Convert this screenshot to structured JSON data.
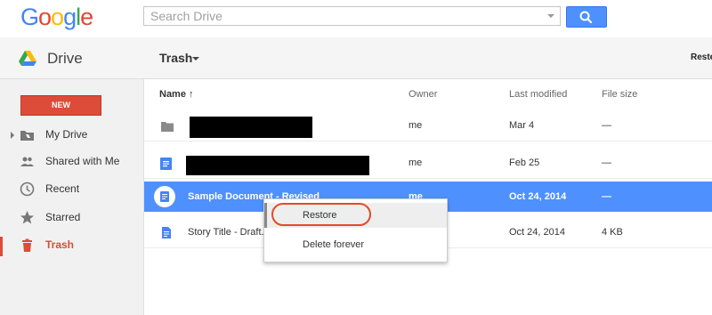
{
  "header": {
    "logo_text": "Google",
    "search": {
      "placeholder": "Search Drive"
    }
  },
  "subheader": {
    "app_name": "Drive",
    "folder_title": "Trash",
    "right_truncated_label": "Reste"
  },
  "sidebar": {
    "new_label": "NEW",
    "items": [
      {
        "label": "My Drive",
        "icon": "drive-folder-icon"
      },
      {
        "label": "Shared with Me",
        "icon": "people-icon"
      },
      {
        "label": "Recent",
        "icon": "clock-icon"
      },
      {
        "label": "Starred",
        "icon": "star-icon"
      },
      {
        "label": "Trash",
        "icon": "trash-icon",
        "active": true
      }
    ]
  },
  "list": {
    "columns": {
      "name": "Name ↑",
      "owner": "Owner",
      "modified": "Last modified",
      "size": "File size"
    },
    "rows": [
      {
        "name": "",
        "owner": "me",
        "modified": "Mar 4",
        "size": "—",
        "icon": "folder-icon"
      },
      {
        "name": "",
        "owner": "me",
        "modified": "Feb 25",
        "size": "—",
        "icon": "doc-icon"
      },
      {
        "name": "Sample Document - Revised",
        "owner": "me",
        "modified": "Oct 24, 2014",
        "size": "—",
        "icon": "doc-icon",
        "selected": true
      },
      {
        "name": "Story Title - Draft.d",
        "owner": "",
        "modified": "Oct 24, 2014",
        "size": "4 KB",
        "icon": "doc-icon"
      }
    ]
  },
  "context_menu": {
    "items": [
      "Restore",
      "Delete forever"
    ]
  },
  "colors": {
    "accent_blue": "#4d90fe",
    "new_button_red": "#dd4b39",
    "annotation_red": "#e34a2a"
  }
}
